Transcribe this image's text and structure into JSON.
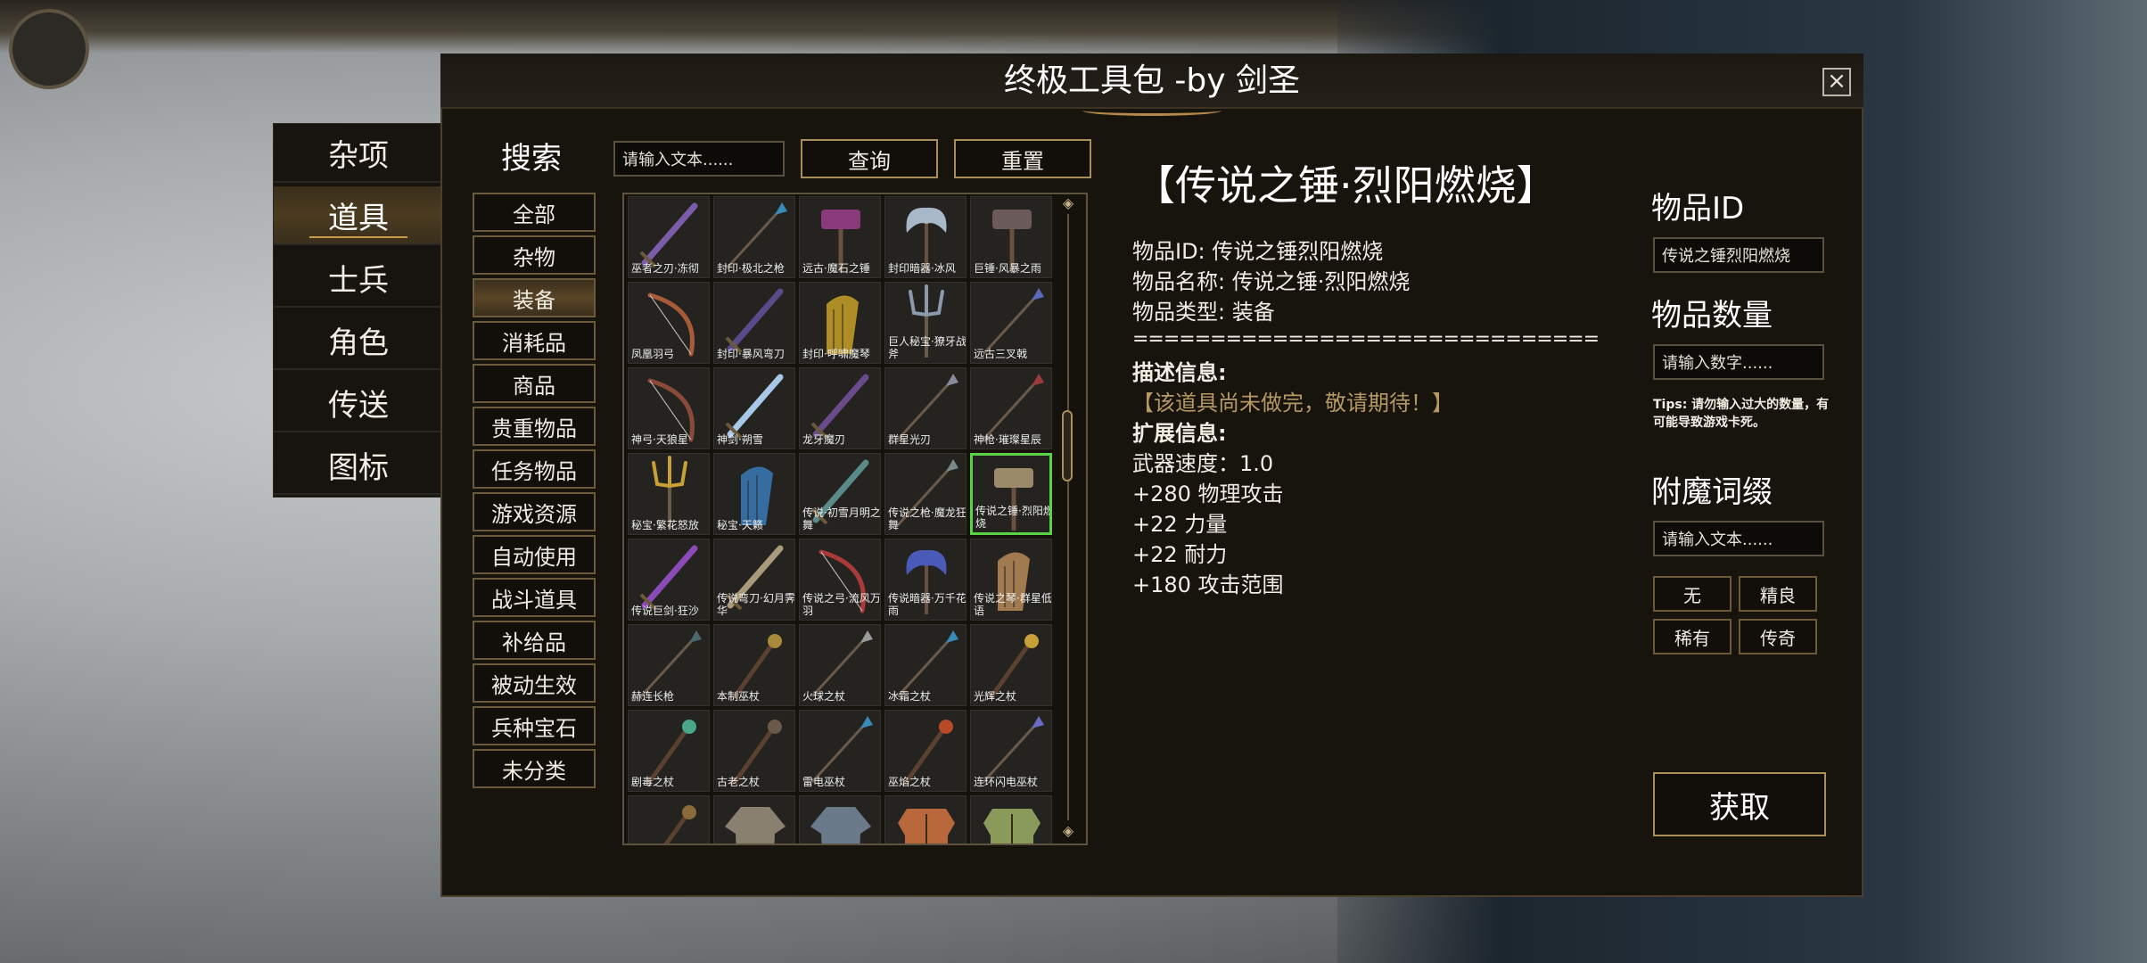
{
  "window": {
    "title": "终极工具包 -by 剑圣",
    "close_icon": "close-icon"
  },
  "side_menu": [
    {
      "label": "杂项",
      "active": false
    },
    {
      "label": "道具",
      "active": true
    },
    {
      "label": "士兵",
      "active": false
    },
    {
      "label": "角色",
      "active": false
    },
    {
      "label": "传送",
      "active": false
    },
    {
      "label": "图标",
      "active": false
    }
  ],
  "search": {
    "label": "搜索",
    "placeholder": "请输入文本......",
    "query_button": "查询",
    "reset_button": "重置"
  },
  "categories": [
    {
      "label": "全部",
      "active": false
    },
    {
      "label": "杂物",
      "active": false
    },
    {
      "label": "装备",
      "active": true
    },
    {
      "label": "消耗品",
      "active": false
    },
    {
      "label": "商品",
      "active": false
    },
    {
      "label": "贵重物品",
      "active": false
    },
    {
      "label": "任务物品",
      "active": false
    },
    {
      "label": "游戏资源",
      "active": false
    },
    {
      "label": "自动使用",
      "active": false
    },
    {
      "label": "战斗道具",
      "active": false
    },
    {
      "label": "补给品",
      "active": false
    },
    {
      "label": "被动生效",
      "active": false
    },
    {
      "label": "兵种宝石",
      "active": false
    },
    {
      "label": "未分类",
      "active": false
    }
  ],
  "items": [
    {
      "name": "巫者之刃·冻彻",
      "icon": "sword",
      "color": "#7a5ca8"
    },
    {
      "name": "封印·极北之枪",
      "icon": "spear",
      "color": "#3a8ab8"
    },
    {
      "name": "远古·魔石之锤",
      "icon": "hammer",
      "color": "#8a3a7a"
    },
    {
      "name": "封印暗器·冰风",
      "icon": "axe",
      "color": "#a8b8c8"
    },
    {
      "name": "巨锤·风暴之雨",
      "icon": "hammer",
      "color": "#6a5a5a"
    },
    {
      "name": "凤凰羽弓",
      "icon": "bow",
      "color": "#a85a3a"
    },
    {
      "name": "封印·暴风弯刀",
      "icon": "sword",
      "color": "#5a4a8a"
    },
    {
      "name": "封印·呼啸魔琴",
      "icon": "harp",
      "color": "#c8a028"
    },
    {
      "name": "巨人秘宝·獠牙战斧",
      "icon": "trident",
      "color": "#8a9aaa"
    },
    {
      "name": "远古三叉戟",
      "icon": "spear",
      "color": "#5a6ab8"
    },
    {
      "name": "神弓·天狼星",
      "icon": "bow",
      "color": "#8a4a3a"
    },
    {
      "name": "神剑·朔雪",
      "icon": "sword",
      "color": "#a8c8e8"
    },
    {
      "name": "龙牙魔刃",
      "icon": "sword",
      "color": "#6a4a8a"
    },
    {
      "name": "群星光刃",
      "icon": "spear",
      "color": "#8a8a9a"
    },
    {
      "name": "神枪·璀璨星辰",
      "icon": "spear",
      "color": "#9a3a3a"
    },
    {
      "name": "秘宝·繁花怒放",
      "icon": "trident",
      "color": "#c8a038"
    },
    {
      "name": "秘宝·天籁",
      "icon": "harp",
      "color": "#3a7ab8"
    },
    {
      "name": "传说·初雪月明之舞",
      "icon": "sword",
      "color": "#5a8a8a"
    },
    {
      "name": "传说之枪·魔龙狂舞",
      "icon": "spear",
      "color": "#7a8a8a"
    },
    {
      "name": "传说之锤·烈阳燃烧",
      "icon": "hammer",
      "color": "#9a8a6a",
      "selected": true
    },
    {
      "name": "传说巨剑·狂沙",
      "icon": "sword",
      "color": "#8a4ab8"
    },
    {
      "name": "传说弯刀·幻月霁华",
      "icon": "sword",
      "color": "#a89a7a"
    },
    {
      "name": "传说之弓·流风万羽",
      "icon": "bow",
      "color": "#a83a3a"
    },
    {
      "name": "传说暗器·万千花雨",
      "icon": "axe",
      "color": "#4a5ab8"
    },
    {
      "name": "传说之琴·群星低语",
      "icon": "harp",
      "color": "#b88a58"
    },
    {
      "name": "赫连长枪",
      "icon": "spear",
      "color": "#4a6a6a"
    },
    {
      "name": "本制巫杖",
      "icon": "staff",
      "color": "#a88a3a"
    },
    {
      "name": "火球之杖",
      "icon": "spear",
      "color": "#9a9a9a"
    },
    {
      "name": "冰霜之杖",
      "icon": "spear",
      "color": "#3a8ab8"
    },
    {
      "name": "光辉之杖",
      "icon": "staff",
      "color": "#c8a038"
    },
    {
      "name": "剧毒之杖",
      "icon": "staff",
      "color": "#4aa88a"
    },
    {
      "name": "古老之杖",
      "icon": "staff",
      "color": "#6a5a4a"
    },
    {
      "name": "雷电巫杖",
      "icon": "spear",
      "color": "#3a8ab8"
    },
    {
      "name": "巫焰之杖",
      "icon": "staff",
      "color": "#b84a2a"
    },
    {
      "name": "连环闪电巫杖",
      "icon": "spear",
      "color": "#6a6ac8"
    },
    {
      "name": "",
      "icon": "staff",
      "color": "#8a6a3a"
    },
    {
      "name": "",
      "icon": "robe",
      "color": "#8a8070"
    },
    {
      "name": "",
      "icon": "robe",
      "color": "#6a7a8a"
    },
    {
      "name": "",
      "icon": "armor",
      "color": "#b8683a"
    },
    {
      "name": "",
      "icon": "armor",
      "color": "#8a9a5a"
    }
  ],
  "detail": {
    "title": "【传说之锤·烈阳燃烧】",
    "id_line": "物品ID: 传说之锤烈阳燃烧",
    "name_line": "物品名称: 传说之锤·烈阳燃烧",
    "type_line": "物品类型: 装备",
    "separator": "==============================",
    "desc_header": "描述信息:",
    "desc_text": "【该道具尚未做完，敬请期待！】",
    "ext_header": "扩展信息:",
    "stats": [
      "武器速度：1.0",
      "+280 物理攻击",
      "+22 力量",
      "+22 耐力",
      "+180 攻击范围"
    ]
  },
  "right": {
    "id_label": "物品ID",
    "id_value": "传说之锤烈阳燃烧",
    "qty_label": "物品数量",
    "qty_placeholder": "请输入数字......",
    "tips": "Tips: 请勿输入过大的数量，有可能导致游戏卡死。",
    "enchant_label": "附魔词缀",
    "enchant_placeholder": "请输入文本......",
    "quality": [
      "无",
      "精良",
      "稀有",
      "传奇"
    ],
    "get_button": "获取"
  }
}
